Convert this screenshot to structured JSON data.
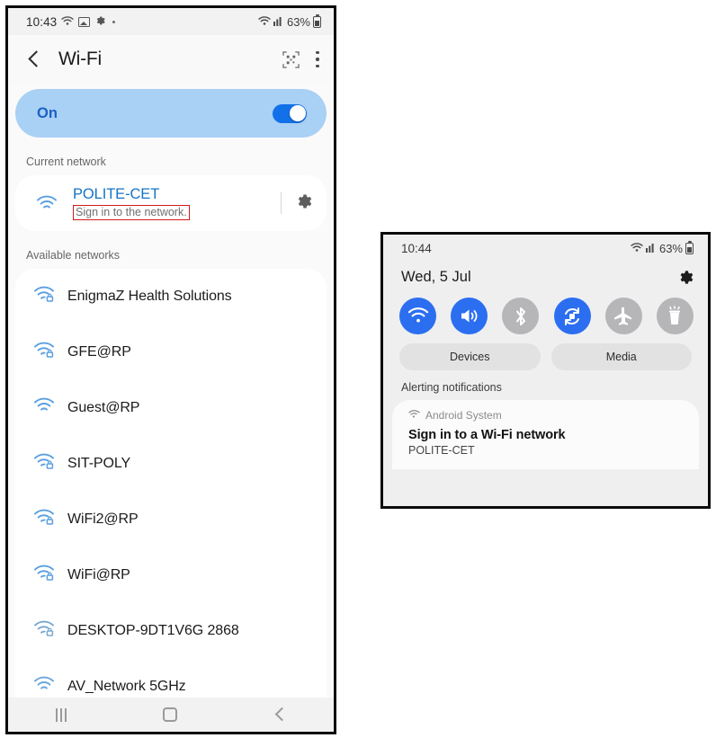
{
  "left_phone": {
    "status_bar": {
      "time": "10:43",
      "icons": [
        "wifi-icon",
        "image-icon",
        "gear-icon",
        "dot-icon"
      ],
      "right_icons": [
        "wifi-signal-icon",
        "cellular-signal-icon"
      ],
      "battery_percent": "63%"
    },
    "app_bar": {
      "back_label": "back",
      "title": "Wi-Fi",
      "qr_label": "qr-scan",
      "more_label": "more-options"
    },
    "wifi_banner": {
      "label": "On",
      "toggle_state": "on"
    },
    "current_network_header": "Current network",
    "current_network": {
      "ssid": "POLITE-CET",
      "status": "Sign in to the network.",
      "settings_label": "settings",
      "highlight_color": "#d01b1b"
    },
    "available_networks_header": "Available networks",
    "available_networks": [
      {
        "ssid": "EnigmaZ Health Solutions",
        "secured": true
      },
      {
        "ssid": "GFE@RP",
        "secured": true
      },
      {
        "ssid": "Guest@RP",
        "secured": false
      },
      {
        "ssid": "SIT-POLY",
        "secured": true
      },
      {
        "ssid": "WiFi2@RP",
        "secured": true
      },
      {
        "ssid": "WiFi@RP",
        "secured": true
      },
      {
        "ssid": "DESKTOP-9DT1V6G 2868",
        "secured": true
      },
      {
        "ssid": "AV_Network 5GHz",
        "secured": false
      }
    ],
    "nav_bar": {
      "recents": "recents",
      "home": "home",
      "back": "back"
    }
  },
  "right_phone": {
    "status_bar": {
      "time": "10:44",
      "battery_percent": "63%"
    },
    "date": "Wed, 5 Jul",
    "settings_label": "settings",
    "quick_toggles": [
      {
        "name": "wifi",
        "state": "on"
      },
      {
        "name": "sound",
        "state": "on"
      },
      {
        "name": "bluetooth",
        "state": "off"
      },
      {
        "name": "auto-rotate",
        "state": "on"
      },
      {
        "name": "airplane-mode",
        "state": "off"
      },
      {
        "name": "flashlight",
        "state": "off"
      }
    ],
    "pills": [
      {
        "label": "Devices"
      },
      {
        "label": "Media"
      }
    ],
    "alerting_header": "Alerting notifications",
    "notification": {
      "app": "Android System",
      "title": "Sign in to a Wi-Fi network",
      "body": "POLITE-CET"
    }
  },
  "colors": {
    "accent_blue": "#2b6ef0",
    "banner_blue": "#a9d0f5",
    "link_blue": "#1573c4",
    "highlight_red": "#d01b1b"
  }
}
